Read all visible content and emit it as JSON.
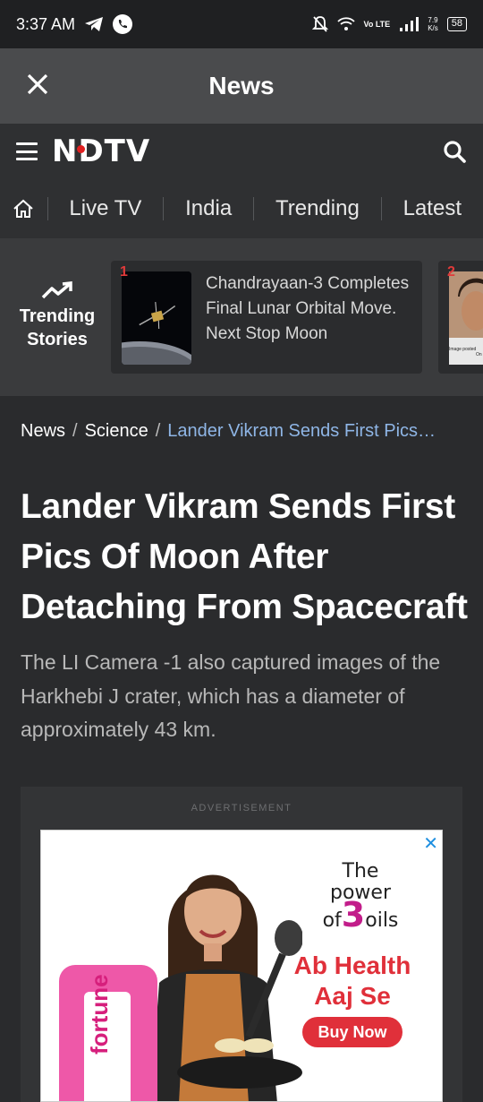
{
  "status_bar": {
    "time": "3:37 AM",
    "speed_value": "7.9",
    "speed_unit": "K/s",
    "network": "Vo LTE",
    "battery": "58"
  },
  "app_bar": {
    "title": "News"
  },
  "site": {
    "logo": "NDTV"
  },
  "nav": {
    "items": [
      "Live TV",
      "India",
      "Trending",
      "Latest"
    ]
  },
  "trending": {
    "label_line1": "Trending",
    "label_line2": "Stories",
    "cards": [
      {
        "rank": "1",
        "title": "Chandrayaan-3 Completes Final Lunar Orbital Move. Next Stop Moon"
      },
      {
        "rank": "2",
        "caption_line1": "Image posted",
        "caption_line2": "On"
      }
    ]
  },
  "breadcrumb": {
    "items": [
      "News",
      "Science"
    ],
    "current": "Lander Vikram Sends First Pics…"
  },
  "article": {
    "headline": "Lander Vikram Sends First Pics Of Moon After Detaching From Spacecraft",
    "summary": "The LI Camera -1 also captured images of the Harkhebi J crater, which has a diameter of approximately 43 km."
  },
  "ad": {
    "label": "ADVERTISEMENT",
    "close": "✕",
    "line1": "The",
    "line2": "power",
    "line3_prefix": "of",
    "line3_num": "3",
    "line3_suffix": "oils",
    "health_line1": "Ab Health",
    "health_line2": "Aaj Se",
    "cta": "Buy Now",
    "brand": "fortune"
  }
}
